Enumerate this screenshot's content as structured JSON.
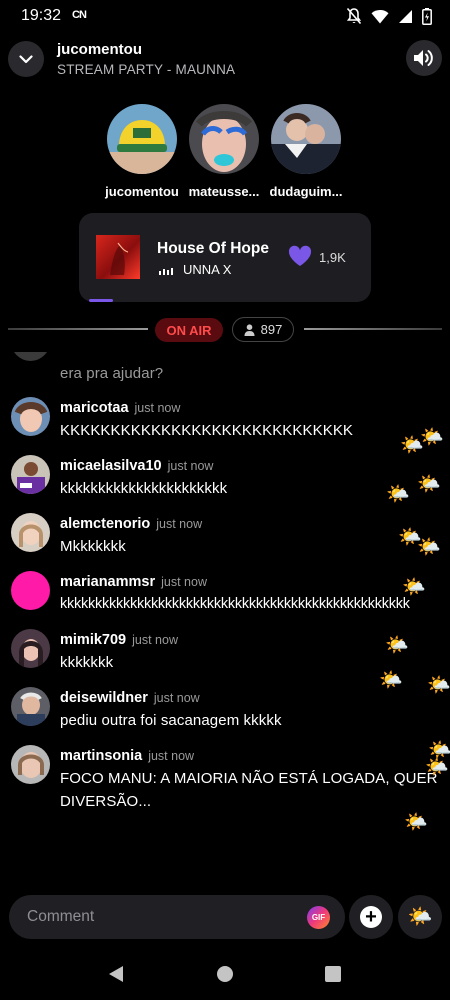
{
  "status_bar": {
    "time": "19:32",
    "carrier_icon": "CN"
  },
  "header": {
    "host": "jucomentou",
    "party_title": "STREAM PARTY - MAUNNA"
  },
  "participants": [
    {
      "name": "jucomentou"
    },
    {
      "name": "mateusse..."
    },
    {
      "name": "dudaguim..."
    }
  ],
  "now_playing": {
    "title": "House Of Hope",
    "artist": "UNNA X",
    "likes": "1,9K",
    "progress_fraction": 0.09
  },
  "live": {
    "on_air_label": "ON AIR",
    "viewer_count": "897"
  },
  "chat": [
    {
      "user": "",
      "time": "",
      "text": "era pra ajudar?"
    },
    {
      "user": "maricotaa",
      "time": "just now",
      "text": "KKKKKKKKKKKKKKKKKKKKKKKKKKKKK"
    },
    {
      "user": "micaelasilva10",
      "time": "just now",
      "text": "kkkkkkkkkkkkkkkkkkkkkk"
    },
    {
      "user": "alemctenorio",
      "time": "just now",
      "text": "Mkkkkkkk"
    },
    {
      "user": "marianammsr",
      "time": "just now",
      "text": "kkkkkkkkkkkkkkkkkkkkkkkkkkkkkkkkkkkkkkkkkkkkkkkkkk"
    },
    {
      "user": "mimik709",
      "time": "just now",
      "text": "kkkkkkk"
    },
    {
      "user": "deisewildner",
      "time": "just now",
      "text": "pediu outra foi sacanagem kkkkk"
    },
    {
      "user": "martinsonia",
      "time": "just now",
      "text": "FOCO MANU: A MAIORIA NÃO ESTÁ LOGADA, QUER DIVERSÃO..."
    }
  ],
  "comment": {
    "placeholder": "Comment",
    "gif_label": "GIF"
  },
  "icons": {
    "reaction_emoji": "🌤️",
    "accent": "#7b57e8",
    "on_air_color": "#ff4b4b",
    "avatar_pink": "#ff1aa8"
  }
}
